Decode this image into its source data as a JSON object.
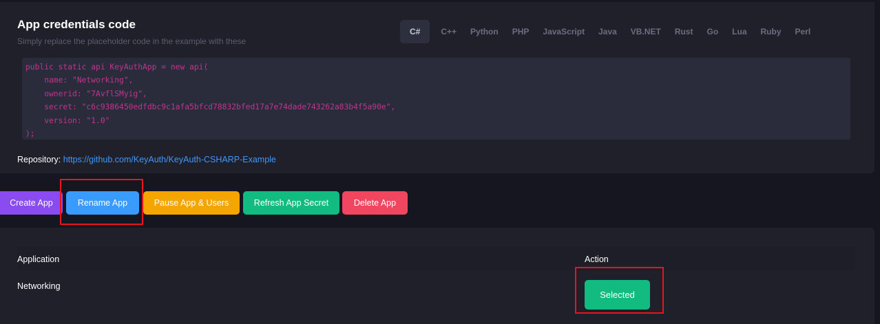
{
  "header": {
    "title": "App credentials code",
    "subtitle": "Simply replace the placeholder code in the example with these"
  },
  "language_tabs": [
    {
      "label": "C#",
      "active": true
    },
    {
      "label": "C++",
      "active": false
    },
    {
      "label": "Python",
      "active": false
    },
    {
      "label": "PHP",
      "active": false
    },
    {
      "label": "JavaScript",
      "active": false
    },
    {
      "label": "Java",
      "active": false
    },
    {
      "label": "VB.NET",
      "active": false
    },
    {
      "label": "Rust",
      "active": false
    },
    {
      "label": "Go",
      "active": false
    },
    {
      "label": "Lua",
      "active": false
    },
    {
      "label": "Ruby",
      "active": false
    },
    {
      "label": "Perl",
      "active": false
    }
  ],
  "code": {
    "line1": "public static api KeyAuthApp = new api(",
    "line2": "    name: \"Networking\",",
    "line3": "    ownerid: \"7AvflSMyig\",",
    "line4": "    secret: \"c6c9386450edfdbc9c1afa5bfcd78832bfed17a7e74dade743262a83b4f5a90e\",",
    "line5": "    version: \"1.0\"",
    "line6": ");"
  },
  "repository": {
    "label": "Repository:",
    "url": "https://github.com/KeyAuth/KeyAuth-CSHARP-Example"
  },
  "actions": {
    "create": "Create App",
    "rename": "Rename App",
    "pause": "Pause App & Users",
    "refresh": "Refresh App Secret",
    "delete": "Delete App"
  },
  "table": {
    "col_application": "Application",
    "col_action": "Action",
    "rows": [
      {
        "application": "Networking",
        "action": "Selected"
      }
    ]
  },
  "colors": {
    "code_text": "#c0348f",
    "link": "#3e97ff",
    "highlight": "#e8141e"
  }
}
